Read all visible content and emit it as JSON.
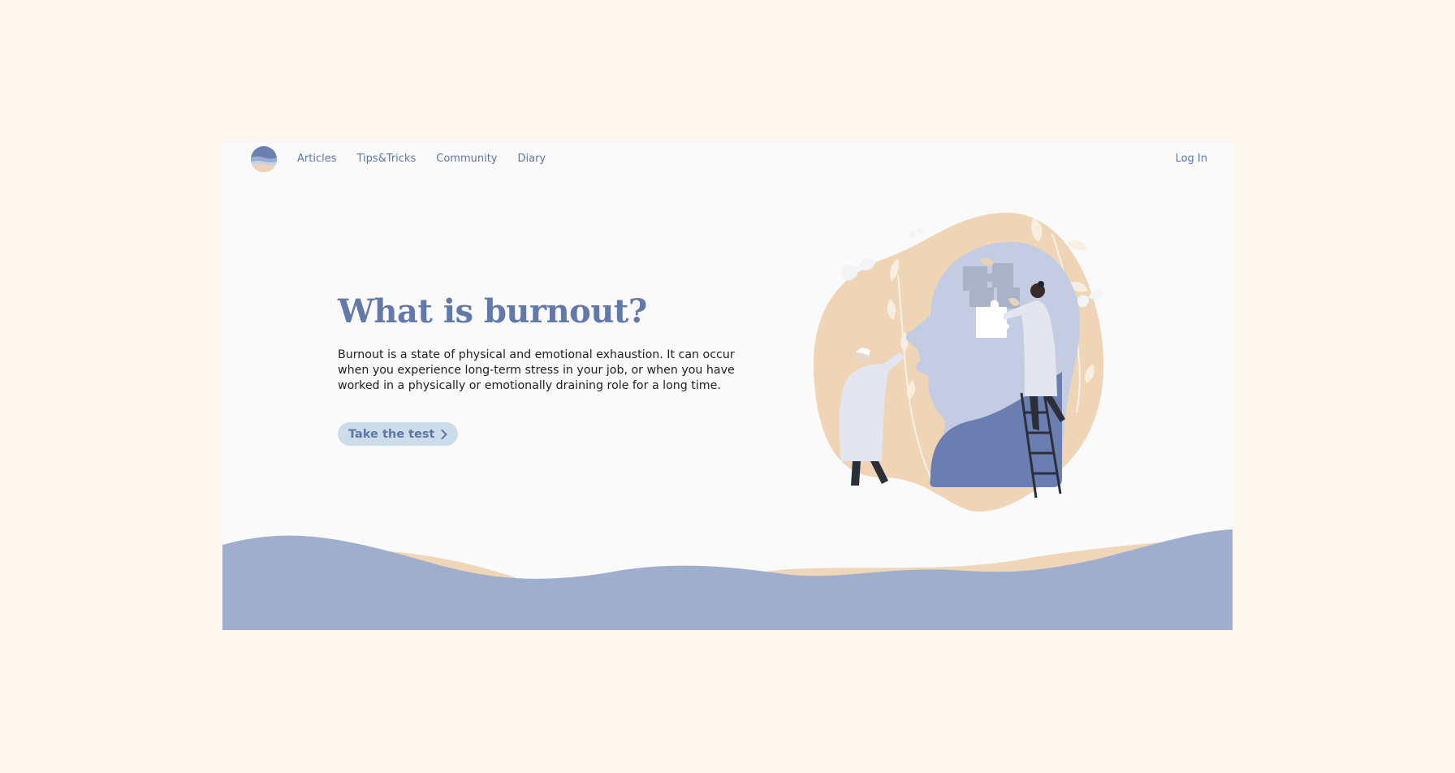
{
  "nav": {
    "logo_icon": "sea-horizon-logo-icon",
    "links": [
      {
        "label": "Articles"
      },
      {
        "label": "Tips&Tricks"
      },
      {
        "label": "Community"
      },
      {
        "label": "Diary"
      }
    ],
    "login_label": "Log In"
  },
  "hero": {
    "title": "What is burnout?",
    "description": "Burnout is a state of physical and emotional exhaustion. It can occur when you experience long-term stress in your job, or when you have worked in a physically or emotionally draining role for a long time.",
    "cta_label": "Take the test",
    "cta_icon": "chevron-right-icon"
  },
  "colors": {
    "page_background": "#fdf7ed",
    "frame_background": "#fafafa",
    "accent": "#6378ab",
    "button_background": "#cddceb",
    "wave_blue": "#9faecd",
    "wave_sand": "#efd6b8"
  }
}
